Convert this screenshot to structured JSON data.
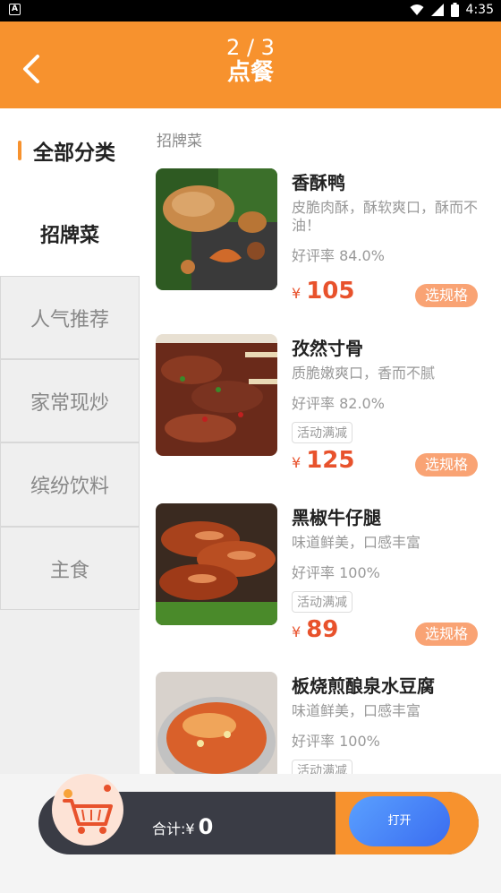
{
  "status": {
    "time": "4:35"
  },
  "header": {
    "page_num": "2 / 3",
    "title": "点餐"
  },
  "sidebar": {
    "heading": "全部分类",
    "items": [
      {
        "label": "招牌菜",
        "active": true
      },
      {
        "label": "人气推荐"
      },
      {
        "label": "家常现炒"
      },
      {
        "label": "缤纷饮料"
      },
      {
        "label": "主食"
      }
    ]
  },
  "section_title": "招牌菜",
  "dishes": [
    {
      "name": "香酥鸭",
      "desc": "皮脆肉酥，酥软爽口，酥而不油！",
      "rate": "好评率 84.0%",
      "tag": "",
      "yen": "¥",
      "price": "105",
      "spec": "选规格"
    },
    {
      "name": "孜然寸骨",
      "desc": "质脆嫩爽口，香而不腻",
      "rate": "好评率 82.0%",
      "tag": "活动满减",
      "yen": "¥",
      "price": "125",
      "spec": "选规格"
    },
    {
      "name": "黑椒牛仔腿",
      "desc": "味道鲜美，口感丰富",
      "rate": "好评率 100%",
      "tag": "活动满减",
      "yen": "¥",
      "price": "89",
      "spec": "选规格"
    },
    {
      "name": "板烧煎酿泉水豆腐",
      "desc": "味道鲜美，口感丰富",
      "rate": "好评率 100%",
      "tag": "活动满减",
      "yen": "",
      "price": "",
      "spec": ""
    }
  ],
  "cart": {
    "total_label": "合计:¥",
    "total_value": "0",
    "open_label": "打开"
  },
  "colors": {
    "accent": "#f7922e",
    "price": "#e8522c",
    "spec_button": "#f9a374"
  }
}
